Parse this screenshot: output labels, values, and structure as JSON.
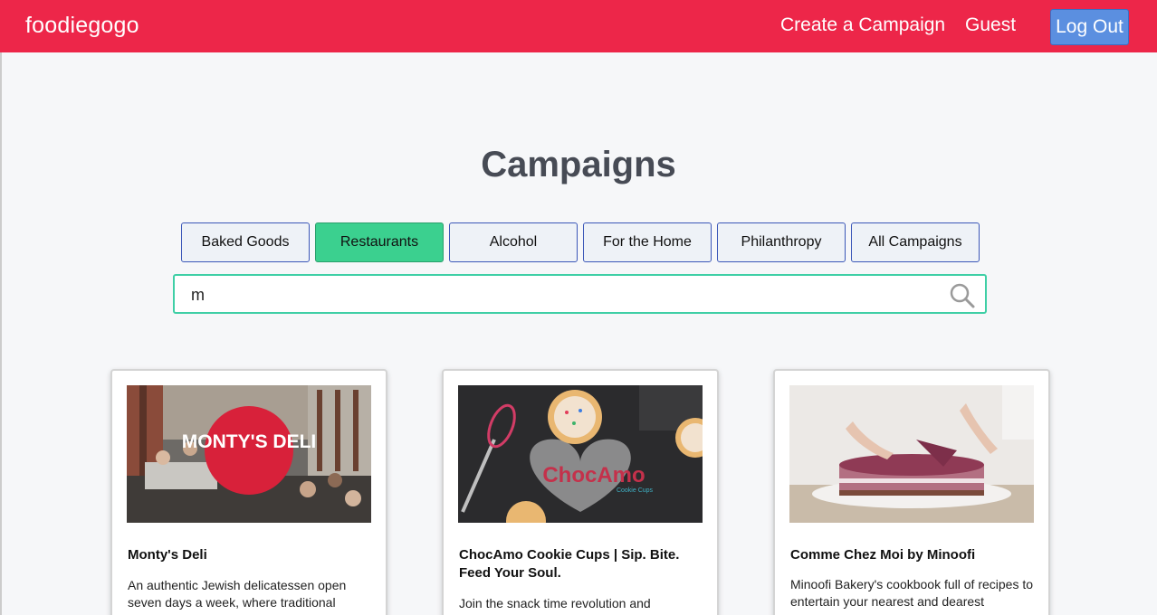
{
  "navbar": {
    "logo": "foodiegogo",
    "create_campaign": "Create a Campaign",
    "user": "Guest",
    "logout": "Log Out",
    "accent_color": "#ed2649"
  },
  "main": {
    "title": "Campaigns",
    "categories": [
      {
        "label": "Baked Goods",
        "active": false
      },
      {
        "label": "Restaurants",
        "active": true
      },
      {
        "label": "Alcohol",
        "active": false
      },
      {
        "label": "For the Home",
        "active": false
      },
      {
        "label": "Philanthropy",
        "active": false
      },
      {
        "label": "All Campaigns",
        "active": false
      }
    ],
    "search": {
      "value": "m",
      "icon": "search-icon"
    }
  },
  "campaigns": [
    {
      "image_text": "MONTY'S DELI",
      "title": "Monty's Deli",
      "description": "An authentic Jewish delicatessen open seven days a week, where traditional"
    },
    {
      "image_text": "ChocAmo",
      "image_subtext": "Cookie Cups",
      "title": "ChocAmo Cookie Cups | Sip. Bite. Feed Your Soul.",
      "description": "Join the snack time revolution and"
    },
    {
      "title": "Comme Chez Moi by Minoofi",
      "description": "Minoofi Bakery's cookbook full of recipes to entertain your nearest and dearest"
    }
  ]
}
